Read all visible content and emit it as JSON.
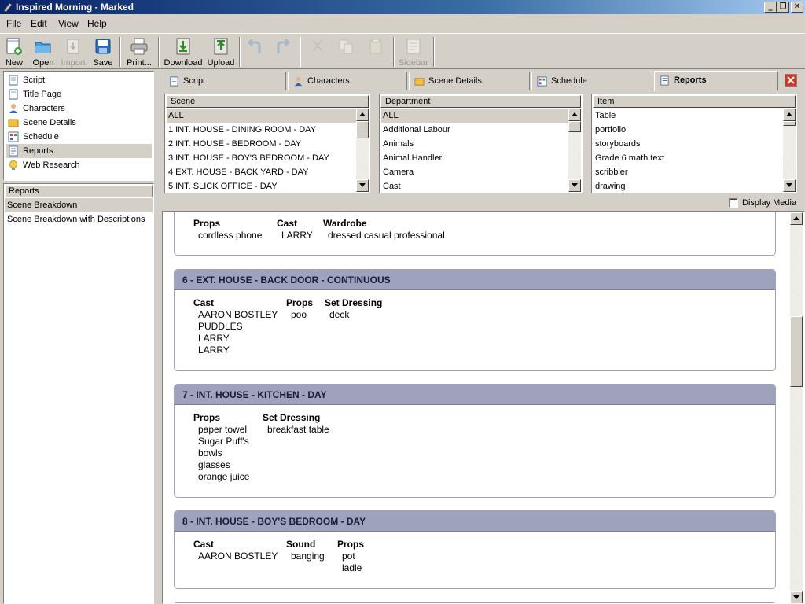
{
  "window": {
    "title": "Inspired Morning - Marked"
  },
  "menu": [
    "File",
    "Edit",
    "View",
    "Help"
  ],
  "toolbar": {
    "new": "New",
    "open": "Open",
    "import": "Import",
    "save": "Save",
    "print": "Print...",
    "download": "Download",
    "upload": "Upload",
    "sidebar": "Sidebar"
  },
  "nav": {
    "items": [
      "Script",
      "Title Page",
      "Characters",
      "Scene Details",
      "Schedule",
      "Reports",
      "Web Research"
    ],
    "selected": "Reports"
  },
  "reports": {
    "header": "Reports",
    "items": [
      "Scene Breakdown",
      "Scene Breakdown with Descriptions"
    ],
    "selected": "Scene Breakdown"
  },
  "tabs": [
    "Script",
    "Characters",
    "Scene Details",
    "Schedule",
    "Reports"
  ],
  "active_tab": "Reports",
  "filters": {
    "scene": {
      "header": "Scene",
      "rows": [
        "ALL",
        "1 INT. HOUSE - DINING ROOM - DAY",
        "2 INT. HOUSE - BEDROOM - DAY",
        "3 INT. HOUSE - BOY'S BEDROOM - DAY",
        "4 EXT. HOUSE - BACK YARD - DAY",
        "5 INT. SLICK OFFICE - DAY"
      ]
    },
    "department": {
      "header": "Department",
      "rows": [
        "ALL",
        "Additional Labour",
        "Animals",
        "Animal Handler",
        "Camera",
        "Cast"
      ]
    },
    "item": {
      "header": "Item",
      "rows": [
        "Table",
        "portfolio",
        "storyboards",
        "Grade 6 math text",
        "scribbler",
        "drawing"
      ]
    }
  },
  "display_media": {
    "label": "Display Media",
    "checked": false
  },
  "report_cards": [
    {
      "title": "",
      "columns": [
        {
          "header": "Props",
          "values": [
            "cordless phone"
          ]
        },
        {
          "header": "Cast",
          "values": [
            "LARRY"
          ]
        },
        {
          "header": "Wardrobe",
          "values": [
            "dressed casual professional"
          ]
        }
      ]
    },
    {
      "title": "6 - EXT. HOUSE - BACK DOOR - CONTINUOUS",
      "columns": [
        {
          "header": "Cast",
          "values": [
            "AARON BOSTLEY",
            "PUDDLES",
            "LARRY",
            "LARRY"
          ]
        },
        {
          "header": "Props",
          "values": [
            "poo"
          ]
        },
        {
          "header": "Set Dressing",
          "values": [
            "deck"
          ]
        }
      ]
    },
    {
      "title": "7 - INT. HOUSE - KITCHEN - DAY",
      "columns": [
        {
          "header": "Props",
          "values": [
            "paper towel",
            "Sugar Puff's",
            "bowls",
            "glasses",
            "orange juice"
          ]
        },
        {
          "header": "Set Dressing",
          "values": [
            "breakfast table"
          ]
        }
      ]
    },
    {
      "title": "8 - INT. HOUSE - BOY'S BEDROOM - DAY",
      "columns": [
        {
          "header": "Cast",
          "values": [
            "AARON BOSTLEY"
          ]
        },
        {
          "header": "Sound",
          "values": [
            "banging"
          ]
        },
        {
          "header": "Props",
          "values": [
            "pot",
            "ladle"
          ]
        }
      ]
    }
  ],
  "colors": {
    "card_header": "#9ea2bd",
    "selection": "#d4d0c8",
    "titlebar": "#0a246a"
  }
}
